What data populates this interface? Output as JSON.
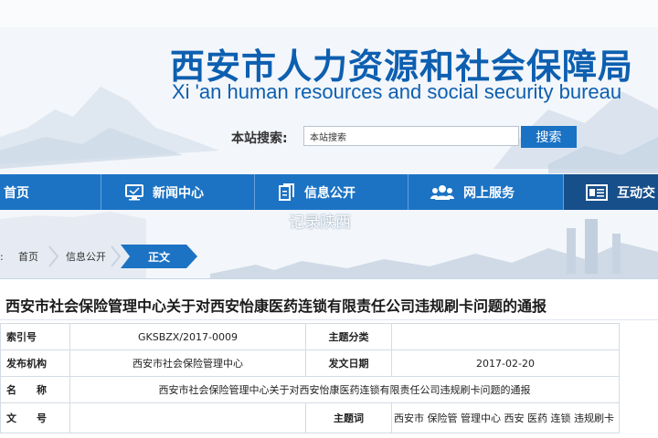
{
  "header": {
    "title": "西安市人力资源和社会保障局",
    "subtitle": "Xi 'an human resources and social security bureau"
  },
  "search": {
    "label": "本站搜索:",
    "value": "本站搜索",
    "button": "搜索"
  },
  "nav": {
    "items": [
      {
        "label": "首页",
        "icon": "home"
      },
      {
        "label": "新闻中心",
        "icon": "monitor-icon"
      },
      {
        "label": "信息公开",
        "icon": "document-icon"
      },
      {
        "label": "网上服务",
        "icon": "users-icon"
      },
      {
        "label": "互动交",
        "icon": "id-card-icon"
      }
    ]
  },
  "watermark": "记录陕西",
  "breadcrumb": {
    "colon": ":",
    "home": "首页",
    "info": "信息公开",
    "current": "正文"
  },
  "document": {
    "title": "西安市社会保险管理中心关于对西安怡康医药连锁有限责任公司违规刷卡问题的通报",
    "fields": {
      "index_label": "索引号",
      "index_value": "GKSBZX/2017-0009",
      "topic_label": "主题分类",
      "topic_value": "",
      "issuer_label": "发布机构",
      "issuer_value": "西安市社会保险管理中心",
      "date_label": "发文日期",
      "date_value": "2017-02-20",
      "name_label": "名　　称",
      "name_value": "西安市社会保险管理中心关于对西安怡康医药连锁有限责任公司违规刷卡问题的通报",
      "docno_label": "文　　号",
      "docno_value": "",
      "keyword_label": "主题词",
      "keyword_value": "西安市 保险管 管理中心 西安 医药 连锁 违规刷卡"
    }
  },
  "colors": {
    "brand_blue": "#0d5fb0",
    "nav_blue": "#1c73c4",
    "nav_dark": "#164f8a",
    "label_blue": "#1a5fa8"
  }
}
